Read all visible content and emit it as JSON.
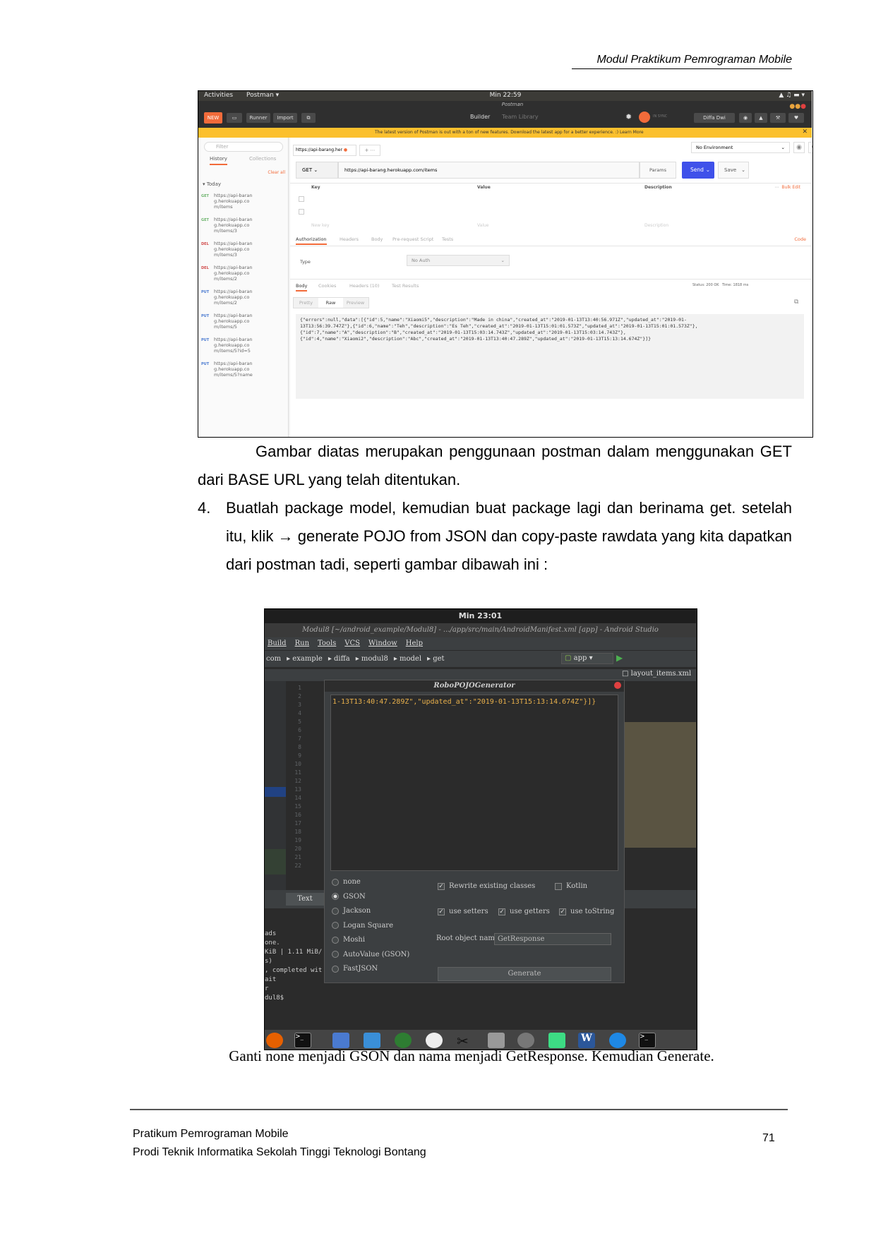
{
  "header": {
    "title": "Modul Praktikum Pemrograman Mobile"
  },
  "postman": {
    "topbar": {
      "activities": "Activities",
      "app": "Postman ▾",
      "clock": "Min 22:59",
      "window_title": "Postman"
    },
    "toolbar": {
      "new": "NEW",
      "runner": "Runner",
      "import": "Import",
      "builder": "Builder",
      "team_library": "Team Library",
      "in_sync": "IN SYNC",
      "user": "Diffa Dwi"
    },
    "banner": "The latest version of Postman is out with a ton of new features. Download the latest app for a better experience. :) Learn More",
    "sidebar": {
      "filter_placeholder": "Filter",
      "tabs": [
        "History",
        "Collections"
      ],
      "clear_all": "Clear all",
      "group": "Today",
      "requests": [
        {
          "method": "GET",
          "url": "https://api-barang.herokuapp.com/items",
          "color": "#6bb36b"
        },
        {
          "method": "GET",
          "url": "https://api-barang.herokuapp.com/items/3",
          "color": "#6bb36b"
        },
        {
          "method": "DEL",
          "url": "https://api-barang.herokuapp.com/items/3",
          "color": "#d04a4a"
        },
        {
          "method": "DEL",
          "url": "https://api-barang.herokuapp.com/items/2",
          "color": "#d04a4a"
        },
        {
          "method": "PUT",
          "url": "https://api-barang.herokuapp.com/items/2",
          "color": "#4a7ad0"
        },
        {
          "method": "PUT",
          "url": "https://api-barang.herokuapp.com/items/5",
          "color": "#4a7ad0"
        },
        {
          "method": "PUT",
          "url": "https://api-barang.herokuapp.com/items/5?id=5",
          "color": "#4a7ad0"
        },
        {
          "method": "PUT",
          "url": "https://api-barang.herokuapp.com/items/5?name",
          "color": "#4a7ad0"
        }
      ]
    },
    "main": {
      "tab_label": "https://api-barang.her",
      "environment": "No Environment",
      "method": "GET",
      "url": "https://api-barang.herokuapp.com/items",
      "params": "Params",
      "send": "Send",
      "save": "Save",
      "table_headers": [
        "Key",
        "Value",
        "Description"
      ],
      "bulk_edit": "Bulk Edit",
      "new_key": "New key",
      "value_ph": "Value",
      "desc_ph": "Description",
      "req_tabs": [
        "Authorization",
        "Headers",
        "Body",
        "Pre-request Script",
        "Tests"
      ],
      "code": "Code",
      "type_label": "Type",
      "auth_value": "No Auth",
      "resp_tabs": [
        "Body",
        "Cookies",
        "Headers (10)",
        "Test Results"
      ],
      "status": "Status: 200 OK",
      "time": "Time: 1818 ms",
      "view_tabs": [
        "Pretty",
        "Raw",
        "Preview"
      ],
      "response": "{\"errors\":null,\"data\":[{\"id\":5,\"name\":\"Xiaomi5\",\"description\":\"Made in china\",\"created_at\":\"2019-01-13T13:40:56.971Z\",\"updated_at\":\"2019-01-\n13T13:56:39.747Z\"},{\"id\":6,\"name\":\"Teh\",\"description\":\"Es Teh\",\"created_at\":\"2019-01-13T15:01:01.573Z\",\"updated_at\":\"2019-01-13T15:01:01.573Z\"},\n{\"id\":7,\"name\":\"A\",\"description\":\"B\",\"created_at\":\"2019-01-13T15:03:14.743Z\",\"updated_at\":\"2019-01-13T15:03:14.743Z\"},\n{\"id\":4,\"name\":\"Xiaomi2\",\"description\":\"Abc\",\"created_at\":\"2019-01-13T13:40:47.289Z\",\"updated_at\":\"2019-01-13T15:13:14.674Z\"}]}"
    }
  },
  "para1": "Gambar diatas merupakan penggunaan postman dalam menggunakan GET dari BASE URL yang telah ditentukan.",
  "step4": {
    "number": "4.",
    "text": "Buatlah package model, kemudian buat package lagi dan berinama get. setelah itu, klik → generate POJO from JSON dan copy-paste rawdata yang kita dapatkan dari postman tadi, seperti gambar dibawah ini :"
  },
  "android_studio": {
    "clock": "Min 23:01",
    "title": "Modul8 [~/android_example/Modul8] - .../app/src/main/AndroidManifest.xml [app] - Android Studio",
    "menu": [
      "Build",
      "Run",
      "Tools",
      "VCS",
      "Window",
      "Help"
    ],
    "breadcrumbs": [
      "com",
      "example",
      "diffa",
      "modul8",
      "model",
      "get"
    ],
    "run_config": "app",
    "tab_right": "layout_items.xml",
    "line_numbers": [
      "1",
      "2",
      "3",
      "4",
      "5",
      "6",
      "7",
      "8",
      "9",
      "10",
      "11",
      "12",
      "13",
      "14",
      "15",
      "16",
      "17",
      "18",
      "19",
      "20",
      "21",
      "22"
    ],
    "text_tab": "Text",
    "terminal_lines": [
      "ads",
      "one.",
      "KiB | 1.11 MiB/",
      "s)",
      ", completed wit",
      "ait",
      "r",
      "dul8$"
    ],
    "dialog": {
      "title": "RoboPOJOGenerator",
      "editor_text_1": "1-13T13:40:47.289Z\",",
      "editor_text_2": "\"updated_at\"",
      "editor_text_3": ":\"2019-01-13T15:13:14.674Z\"}]}",
      "frameworks": [
        "none",
        "GSON",
        "Jackson",
        "Logan Square",
        "Moshi",
        "AutoValue (GSON)",
        "FastJSON"
      ],
      "selected": "GSON",
      "rewrite": "Rewrite existing classes",
      "kotlin": "Kotlin",
      "setters": "use setters",
      "getters": "use getters",
      "tostring": "use toString",
      "root_label": "Root object name",
      "root_value": "GetResponse",
      "generate": "Generate"
    }
  },
  "caption": "Ganti none menjadi GSON dan nama menjadi GetResponse. Kemudian Generate.",
  "footer": {
    "line1": "Pratikum Pemrograman Mobile",
    "line2": "Prodi Teknik Informatika Sekolah Tinggi Teknologi Bontang",
    "page": "71"
  }
}
